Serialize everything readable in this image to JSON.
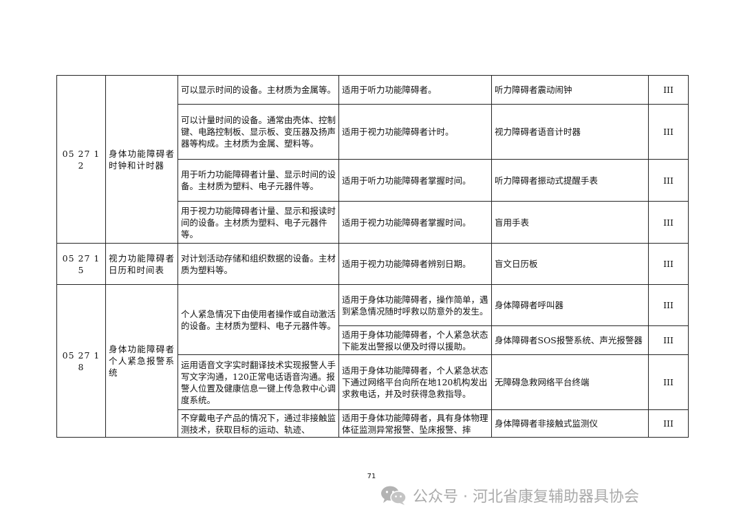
{
  "table": {
    "groups": [
      {
        "code": "05 27 12",
        "category": "身体功能障碍者时钟和计时器",
        "rows": [
          {
            "desc": "可以显示时间的设备。主材质为金属等。",
            "use": "适用于听力功能障碍者。",
            "name": "听力障碍者震动闹钟",
            "class": "III"
          },
          {
            "desc": "可以计量时间的设备。通常由壳体、控制键、电路控制板、显示板、变压器及扬声器等构成。主材质为金属、塑料等。",
            "use": "适用于视力功能障碍者计时。",
            "name": "视力障碍者语音计时器",
            "class": "III"
          },
          {
            "desc": "用于听力功能障碍者计量、显示时间的设备。主材质为塑料、电子元器件等。",
            "use": "适用于听力功能障碍者掌握时间。",
            "name": "听力障碍者振动式提醒手表",
            "class": "III"
          },
          {
            "desc": "用于视力功能障碍者计量、显示和报读时间的设备。主材质为塑料、电子元器件等。",
            "use": "适用于视力功能障碍者掌握时间。",
            "name": "盲用手表",
            "class": "III"
          }
        ]
      },
      {
        "code": "05 27 15",
        "category": "视力功能障碍者日历和时间表",
        "rows": [
          {
            "desc": "对计划活动存储和组织数据的设备。主材质为塑料等。",
            "use": "适用于视力功能障碍者辨别日期。",
            "name": "盲文日历板",
            "class": "III"
          }
        ]
      },
      {
        "code": "05 27 18",
        "category": "身体功能障碍者个人紧急报警系统",
        "desc_shared": "个人紧急情况下由使用者操作或自动激活的设备。主材质为塑料、电子元器件等。",
        "rows": [
          {
            "use": "适用于身体功能障碍者，操作简单，遇到紧急情况随时呼救以防意外的发生。",
            "name": "身体障碍者呼叫器",
            "class": "III"
          },
          {
            "use": "适用于身体功能障碍者，个人紧急状态下能发出警报以便及时得以援助。",
            "name": "身体障碍者SOS报警系统、声光报警器",
            "class": "III"
          },
          {
            "desc": "运用语音文字实时翻译技术实现报警人手写文字沟通，120正常电话语音沟通。报警人位置及健康信息一键上传急救中心调度系统。",
            "use": "适用于身体功能障碍者，个人紧急状态下通过网络平台向所在地120机构发出求救电话，并及时获得急救指导。",
            "name": "无障碍急救网络平台终端",
            "class": "III"
          },
          {
            "desc": "不穿戴电子产品的情况下，通过非接触监测技术，获取目标的运动、轨迹、",
            "use": "适用于身体功能障碍者，具有身体物理体征监测异常报警、坠床报警、摔",
            "name": "身体障碍者非接触式监测仪",
            "class": "III"
          }
        ]
      }
    ]
  },
  "page_number": "71",
  "watermark": {
    "text": "公众号 · 河北省康复辅助器具协会",
    "icon": "wechat-icon",
    "color": "#aaaaaa"
  }
}
